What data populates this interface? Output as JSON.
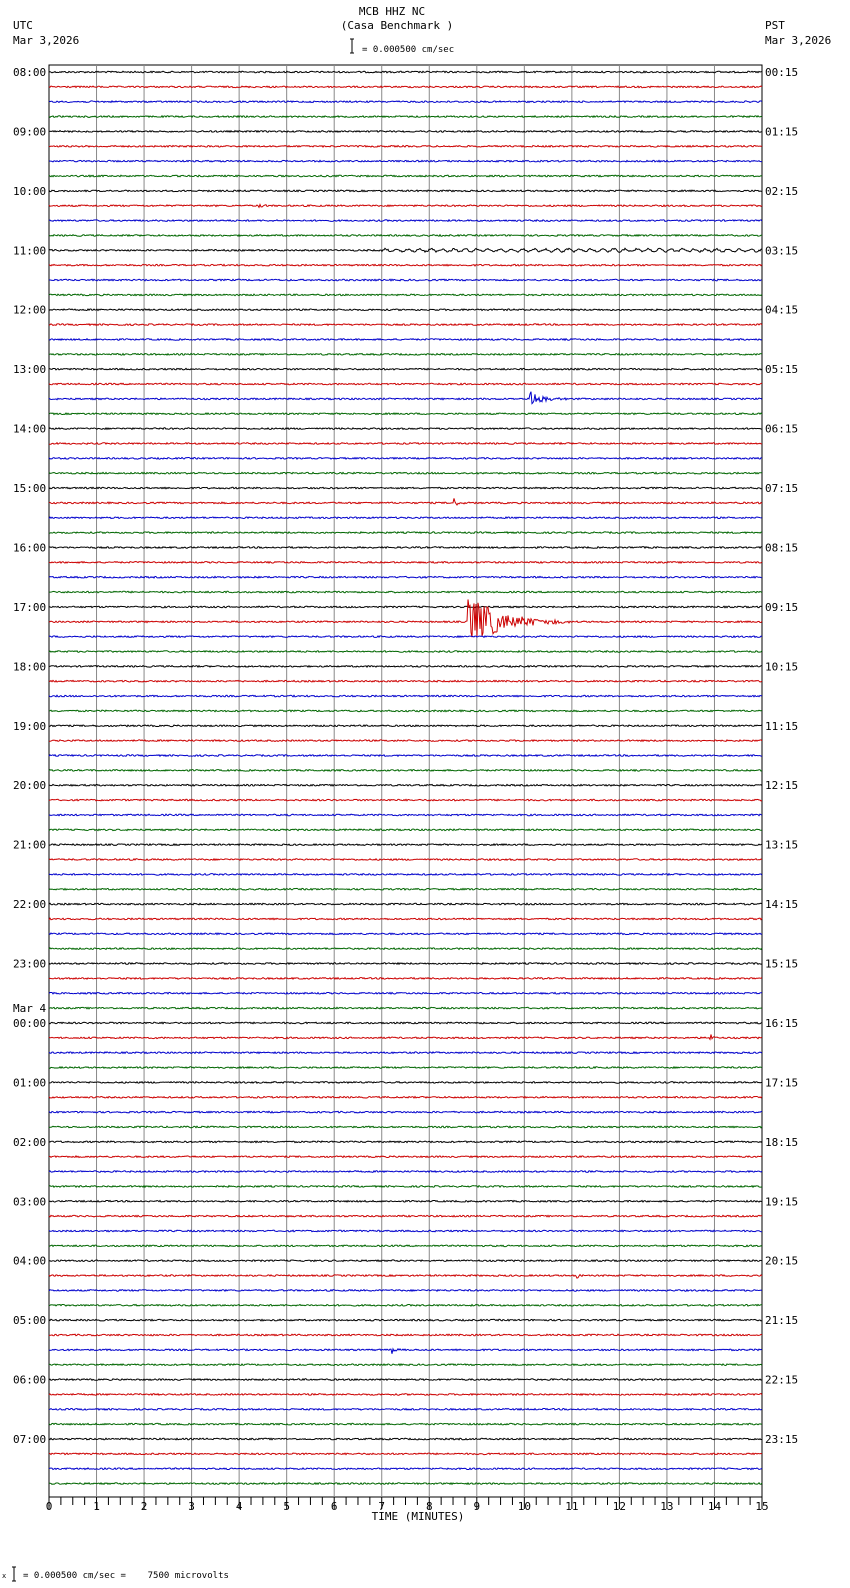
{
  "chart_data": {
    "type": "line",
    "title": "MCB HHZ NC",
    "subtitle": "(Casa Benchmark )",
    "left_tz": "UTC",
    "left_date": "Mar 3,2026",
    "right_tz": "PST",
    "right_date": "Mar 3,2026",
    "scale_label": "= 0.000500 cm/sec",
    "footer_label": "= 0.000500 cm/sec =    7500 microvolts",
    "footer_mark": "x",
    "xlabel": "TIME (MINUTES)",
    "xlim": [
      0,
      15
    ],
    "x_ticks": [
      "0",
      "1",
      "2",
      "3",
      "4",
      "5",
      "6",
      "7",
      "8",
      "9",
      "10",
      "11",
      "12",
      "13",
      "14",
      "15"
    ],
    "trace_colors": [
      "#000000",
      "#cc0000",
      "#0000cc",
      "#006600"
    ],
    "left_labels": [
      "08:00",
      "09:00",
      "10:00",
      "11:00",
      "12:00",
      "13:00",
      "14:00",
      "15:00",
      "16:00",
      "17:00",
      "18:00",
      "19:00",
      "20:00",
      "21:00",
      "22:00",
      "23:00",
      "00:00",
      "01:00",
      "02:00",
      "03:00",
      "04:00",
      "05:00",
      "06:00",
      "07:00"
    ],
    "date_change_label": "Mar 4",
    "right_labels": [
      "00:15",
      "01:15",
      "02:15",
      "03:15",
      "04:15",
      "05:15",
      "06:15",
      "07:15",
      "08:15",
      "09:15",
      "10:15",
      "11:15",
      "12:15",
      "13:15",
      "14:15",
      "15:15",
      "16:15",
      "17:15",
      "18:15",
      "19:15",
      "20:15",
      "21:15",
      "22:15",
      "23:15"
    ],
    "trace_count": 96,
    "events": [
      {
        "trace": 9,
        "minute": 4.4,
        "amp": 3,
        "dur": 0.3
      },
      {
        "trace": 22,
        "minute": 10.1,
        "amp": 10,
        "dur": 0.8
      },
      {
        "trace": 29,
        "minute": 8.5,
        "amp": 6,
        "dur": 0.3
      },
      {
        "trace": 37,
        "minute": 8.8,
        "amp": 28,
        "dur": 2.2
      },
      {
        "trace": 65,
        "minute": 13.9,
        "amp": 7,
        "dur": 0.2
      },
      {
        "trace": 81,
        "minute": 11.1,
        "amp": 3,
        "dur": 0.4
      },
      {
        "trace": 86,
        "minute": 7.2,
        "amp": 5,
        "dur": 0.3
      }
    ]
  }
}
